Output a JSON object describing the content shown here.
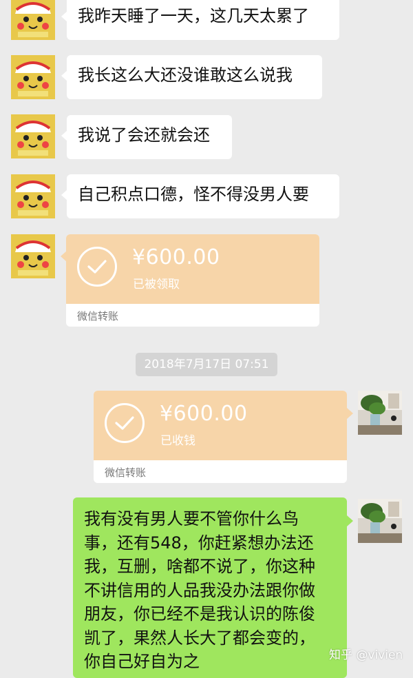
{
  "messages": [
    {
      "text": "我昨天睡了一天，这几天太累了"
    },
    {
      "text": "我长这么大还没谁敢这么说我"
    },
    {
      "text": "我说了会还就会还"
    },
    {
      "text": "自己积点口德，怪不得没男人要"
    }
  ],
  "transfer_received_by_other": {
    "amount": "¥600.00",
    "status": "已被领取",
    "label": "微信转账"
  },
  "timestamp": "2018年7月17日 07:51",
  "transfer_received_by_me": {
    "amount": "¥600.00",
    "status": "已收钱",
    "label": "微信转账"
  },
  "reply": {
    "lines": [
      "我有没有男人要不管你什么鸟",
      "事，还有548，你赶紧想办法还",
      "我，互删，啥都不说了，你这种",
      "不讲信用的人品我没办法跟你做",
      "朋友，你已经不是我认识的陈俊",
      "凯了，果然人长大了都会变的，",
      "你自己好自为之"
    ]
  },
  "watermark": "知乎 @vivien",
  "colors": {
    "background": "#ebebeb",
    "bubble_white": "#ffffff",
    "bubble_green": "#9fe65e",
    "transfer_orange": "#f7d5a9",
    "timestamp_bg": "#d4d4d4"
  },
  "icons": {
    "left_avatar": "pikachu-avatar-icon",
    "right_avatar": "plant-room-avatar-icon",
    "transfer_check": "check-circle-icon"
  }
}
